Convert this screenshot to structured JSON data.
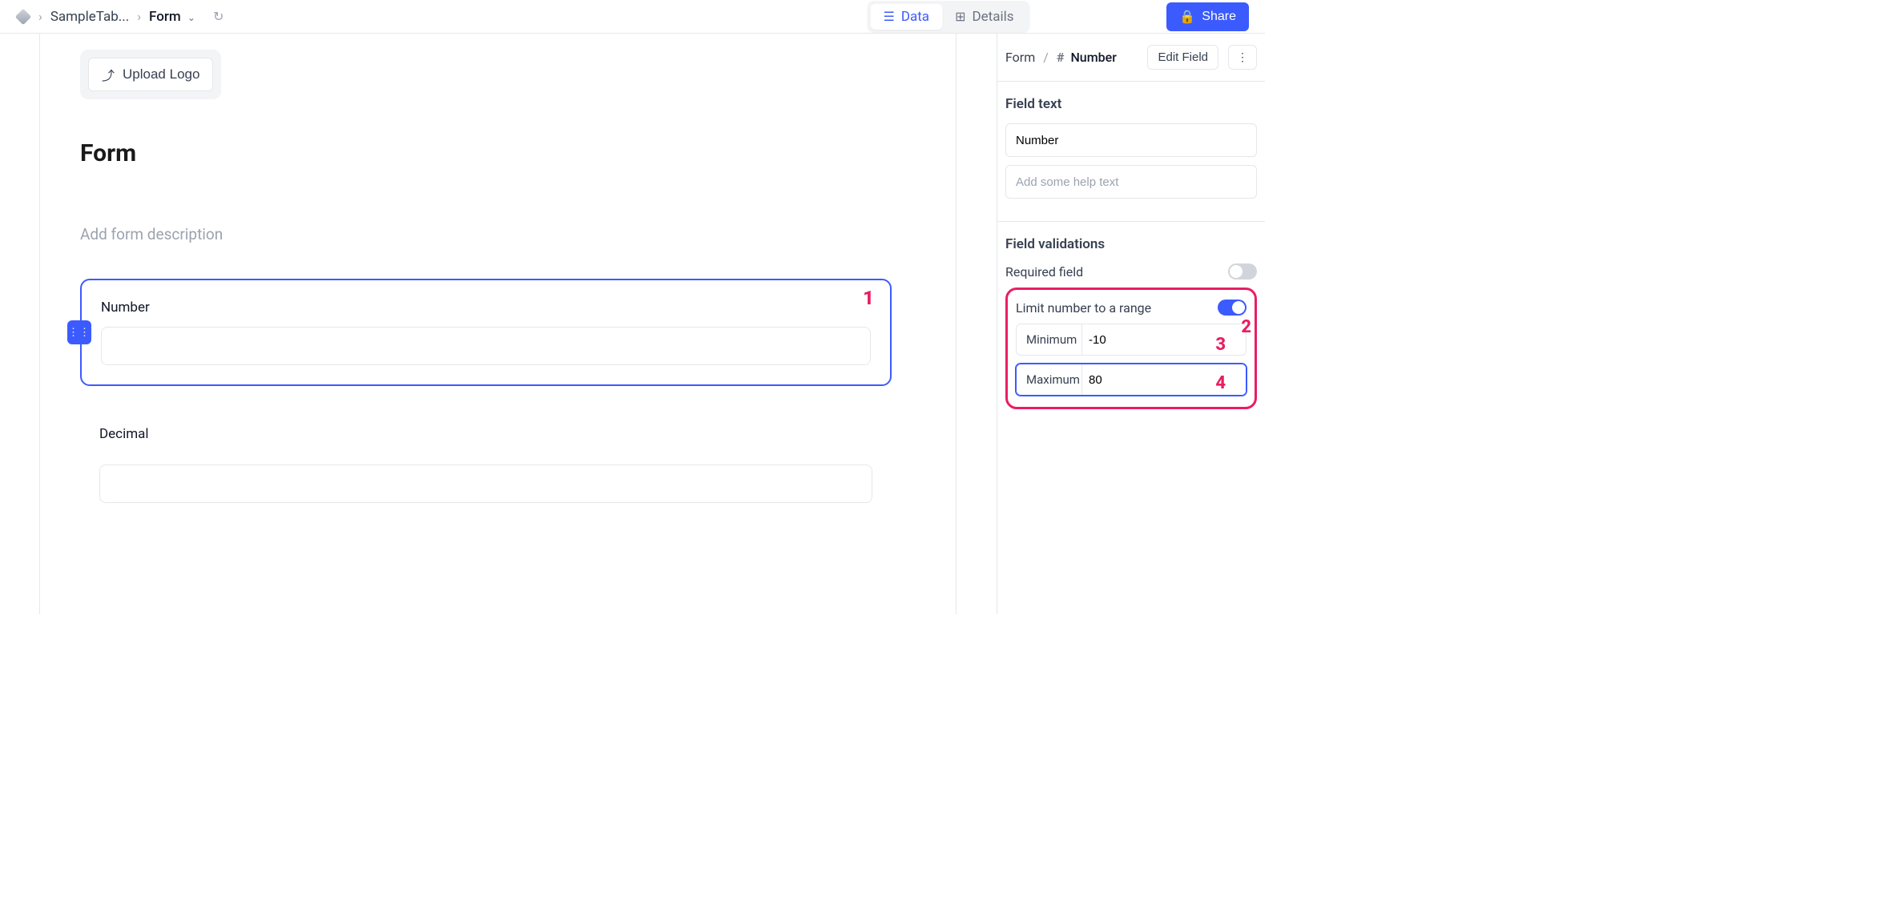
{
  "breadcrumb": {
    "item1": "SampleTab...",
    "item2": "Form"
  },
  "tabs": {
    "data": "Data",
    "details": "Details"
  },
  "share_label": "Share",
  "upload_logo_label": "Upload Logo",
  "form": {
    "title": "Form",
    "description_placeholder": "Add form description",
    "fields": {
      "number": {
        "label": "Number"
      },
      "decimal": {
        "label": "Decimal"
      }
    }
  },
  "sidebar": {
    "crumb_form": "Form",
    "crumb_field": "Number",
    "edit_field_label": "Edit Field",
    "field_text": {
      "title": "Field text",
      "name_value": "Number",
      "help_placeholder": "Add some help text"
    },
    "validations": {
      "title": "Field validations",
      "required_label": "Required field",
      "required_on": false,
      "limit_label": "Limit number to a range",
      "limit_on": true,
      "min_label": "Minimum",
      "min_value": "-10",
      "max_label": "Maximum",
      "max_value": "80"
    }
  },
  "callouts": {
    "c1": "1",
    "c2": "2",
    "c3": "3",
    "c4": "4"
  }
}
